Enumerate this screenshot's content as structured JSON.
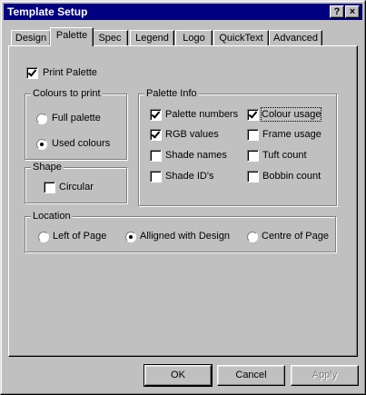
{
  "window": {
    "title": "Template Setup",
    "help_button": "?",
    "close_button": "×"
  },
  "tabs": [
    {
      "label": "Design",
      "active": false
    },
    {
      "label": "Palette",
      "active": true
    },
    {
      "label": "Spec",
      "active": false
    },
    {
      "label": "Legend",
      "active": false
    },
    {
      "label": "Logo",
      "active": false
    },
    {
      "label": "QuickText",
      "active": false
    },
    {
      "label": "Advanced",
      "active": false
    }
  ],
  "print_palette": {
    "label": "Print Palette",
    "checked": true
  },
  "colours_to_print": {
    "title": "Colours to print",
    "options": [
      {
        "label": "Full palette",
        "selected": false
      },
      {
        "label": "Used colours",
        "selected": true
      }
    ]
  },
  "shape": {
    "title": "Shape",
    "circular": {
      "label": "Circular",
      "checked": false
    }
  },
  "palette_info": {
    "title": "Palette Info",
    "items": [
      {
        "label": "Palette numbers",
        "checked": true
      },
      {
        "label": "Colour usage",
        "checked": true
      },
      {
        "label": "RGB values",
        "checked": true
      },
      {
        "label": "Frame usage",
        "checked": false
      },
      {
        "label": "Shade names",
        "checked": false
      },
      {
        "label": "Tuft count",
        "checked": false
      },
      {
        "label": "Shade ID's",
        "checked": false
      },
      {
        "label": "Bobbin count",
        "checked": false
      }
    ]
  },
  "location": {
    "title": "Location",
    "options": [
      {
        "label": "Left of Page",
        "selected": false
      },
      {
        "label": "Alligned with Design",
        "selected": true
      },
      {
        "label": "Centre of Page",
        "selected": false
      }
    ]
  },
  "buttons": {
    "ok": "OK",
    "cancel": "Cancel",
    "apply": "Apply"
  }
}
